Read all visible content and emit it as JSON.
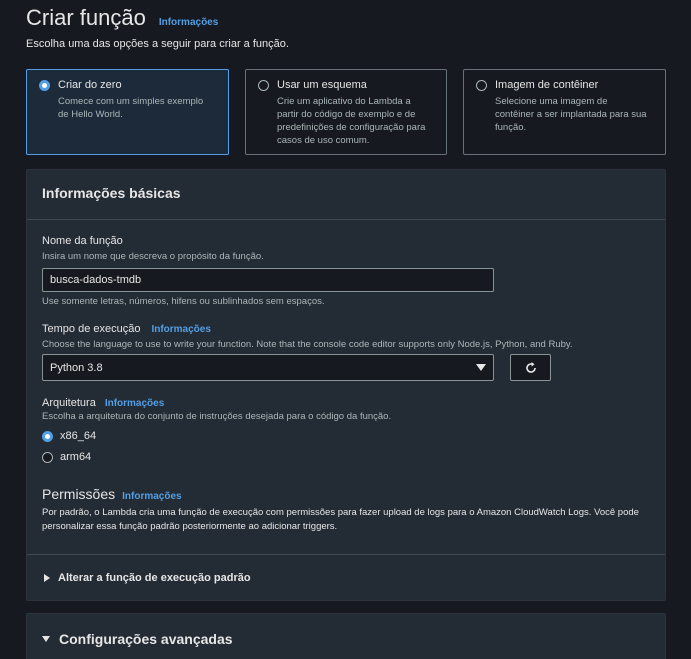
{
  "header": {
    "title": "Criar função",
    "info_link": "Informações",
    "subtitle": "Escolha uma das opções a seguir para criar a função."
  },
  "options": [
    {
      "title": "Criar do zero",
      "desc_line1": "Comece com um simples exemplo",
      "desc_line2": "de Hello World.",
      "selected": true
    },
    {
      "title": "Usar um esquema",
      "desc_line1": "Crie um aplicativo do Lambda a",
      "desc_line2": "partir do código de exemplo e de",
      "desc_line3": "predefinições de configuração para",
      "desc_line4": "casos de uso comum.",
      "selected": false
    },
    {
      "title": "Imagem de contêiner",
      "desc_line1": "Selecione uma imagem de",
      "desc_line2": "contêiner a ser implantada para sua",
      "desc_line3": "função.",
      "selected": false
    }
  ],
  "basic": {
    "title": "Informações básicas",
    "function_name": {
      "label": "Nome da função",
      "description": "Insira um nome que descreva o propósito da função.",
      "value": "busca-dados-tmdb",
      "hint": "Use somente letras, números, hifens ou sublinhados sem espaços."
    },
    "runtime": {
      "label": "Tempo de execução",
      "info_link": "Informações",
      "description": "Choose the language to use to write your function. Note that the console code editor supports only Node.js, Python, and Ruby.",
      "value": "Python 3.8"
    },
    "architecture": {
      "label": "Arquitetura",
      "info_link": "Informações",
      "description": "Escolha a arquitetura do conjunto de instruções desejada para o código da função.",
      "options": [
        "x86_64",
        "arm64"
      ],
      "selected": "x86_64"
    },
    "permissions": {
      "title": "Permissões",
      "info_link": "Informações",
      "desc_line1": "Por padrão, o Lambda cria uma função de execução com permissões para fazer upload de logs para o Amazon CloudWatch Logs. Você pode",
      "desc_line2": "personalizar essa função padrão posteriormente ao adicionar triggers."
    },
    "expander_label": "Alterar a função de execução padrão"
  },
  "advanced": {
    "title": "Configurações avançadas"
  },
  "colors": {
    "background": "#16191f",
    "panel": "#232b35",
    "accent": "#539fe5"
  }
}
